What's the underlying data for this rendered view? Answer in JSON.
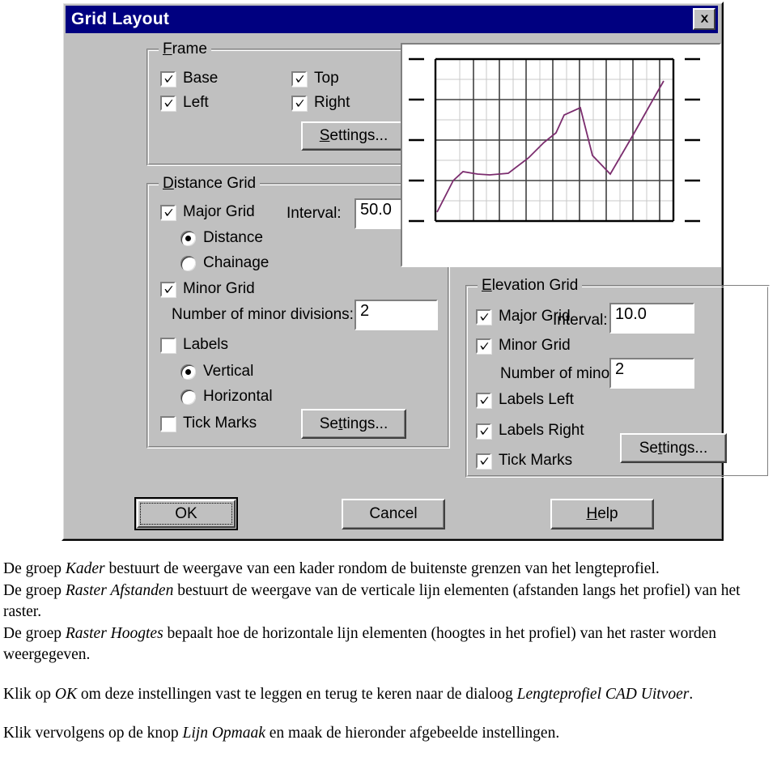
{
  "dialog": {
    "title": "Grid Layout",
    "close_icon": "close-icon"
  },
  "frame_group": {
    "title": "Frame",
    "title_accel": "F",
    "checkboxes": [
      {
        "label": "Base",
        "checked": true
      },
      {
        "label": "Top",
        "checked": true
      },
      {
        "label": "Left",
        "checked": true
      },
      {
        "label": "Right",
        "checked": true
      }
    ],
    "settings_button": "Settings...",
    "settings_accel": "S"
  },
  "distance_group": {
    "title": "Distance Grid",
    "title_accel": "D",
    "major_grid": {
      "label": "Major Grid",
      "checked": true
    },
    "interval_label": "Interval:",
    "interval_value": "50.0",
    "radios": [
      {
        "label": "Distance",
        "selected": true
      },
      {
        "label": "Chainage",
        "selected": false
      }
    ],
    "minor_grid": {
      "label": "Minor Grid",
      "checked": true
    },
    "minor_divisions_label": "Number of minor divisions:",
    "minor_divisions_value": "2",
    "labels_checkbox": {
      "label": "Labels",
      "checked": false
    },
    "orientation_radios": [
      {
        "label": "Vertical",
        "selected": true
      },
      {
        "label": "Horizontal",
        "selected": false
      }
    ],
    "tick_marks": {
      "label": "Tick Marks",
      "checked": false
    },
    "settings_button": "Settings...",
    "settings_accel": "t"
  },
  "elevation_group": {
    "title": "Elevation Grid",
    "title_accel": "E",
    "major_grid": {
      "label": "Major Grid",
      "checked": true
    },
    "interval_label": "Interval:",
    "interval_value": "10.0",
    "minor_grid": {
      "label": "Minor Grid",
      "checked": true
    },
    "minor_divisions_label": "Number of minor divisions:",
    "minor_divisions_value": "2",
    "labels_left": {
      "label": "Labels Left",
      "checked": true
    },
    "labels_right": {
      "label": "Labels Right",
      "checked": true
    },
    "tick_marks": {
      "label": "Tick Marks",
      "checked": true
    },
    "settings_button": "Settings...",
    "settings_accel": "t"
  },
  "buttons": {
    "ok": "OK",
    "cancel": "Cancel",
    "help": "Help",
    "help_accel": "H"
  },
  "chart_data": {
    "type": "line",
    "title": "",
    "xlabel": "",
    "ylabel": "",
    "grid": true,
    "legend": null,
    "line_color": "#7b2d6e",
    "major_grid_color": "#404040",
    "minor_grid_color": "#c8c8c8",
    "major_x_divisions": 5,
    "major_y_divisions": 4,
    "minor_divisions": 2,
    "xlim": [
      0,
      10
    ],
    "ylim": [
      0,
      8
    ],
    "x": [
      0.05,
      0.75,
      1.15,
      1.75,
      2.25,
      3.05,
      3.9,
      4.55,
      5.05,
      5.4,
      6.05,
      6.55,
      7.3,
      8.25,
      9.0,
      9.55
    ],
    "y": [
      0.45,
      2.0,
      2.45,
      2.35,
      2.3,
      2.35,
      3.1,
      3.85,
      4.35,
      5.25,
      5.6,
      3.3,
      2.35,
      4.3,
      5.85,
      6.95
    ]
  },
  "body_text": {
    "paragraphs": [
      {
        "runs": [
          {
            "t": "De groep ",
            "i": false
          },
          {
            "t": "Kader",
            "i": true
          },
          {
            "t": " bestuurt de weergave van een kader rondom de buitenste grenzen van het lengteprofiel.",
            "i": false
          }
        ]
      },
      {
        "runs": [
          {
            "t": "De groep ",
            "i": false
          },
          {
            "t": "Raster Afstanden",
            "i": true
          },
          {
            "t": " bestuurt de weergave van de verticale lijn elementen (afstanden langs het profiel) van het raster.",
            "i": false
          }
        ]
      },
      {
        "runs": [
          {
            "t": "De groep ",
            "i": false
          },
          {
            "t": "Raster Hoogtes",
            "i": true
          },
          {
            "t": " bepaalt hoe de horizontale lijn elementen (hoogtes in het profiel) van het raster worden weergegeven.",
            "i": false
          }
        ]
      },
      {
        "spacer": true
      },
      {
        "runs": [
          {
            "t": "Klik op ",
            "i": false
          },
          {
            "t": "OK",
            "i": true
          },
          {
            "t": " om deze instellingen vast te leggen en terug te keren naar de dialoog ",
            "i": false
          },
          {
            "t": "Lengteprofiel CAD Uitvoer",
            "i": true
          },
          {
            "t": ".",
            "i": false
          }
        ]
      },
      {
        "spacer": true
      },
      {
        "runs": [
          {
            "t": "Klik vervolgens op de knop ",
            "i": false
          },
          {
            "t": "Lijn Opmaak",
            "i": true
          },
          {
            "t": " en maak de hieronder afgebeelde instellingen.",
            "i": false
          }
        ]
      }
    ]
  }
}
